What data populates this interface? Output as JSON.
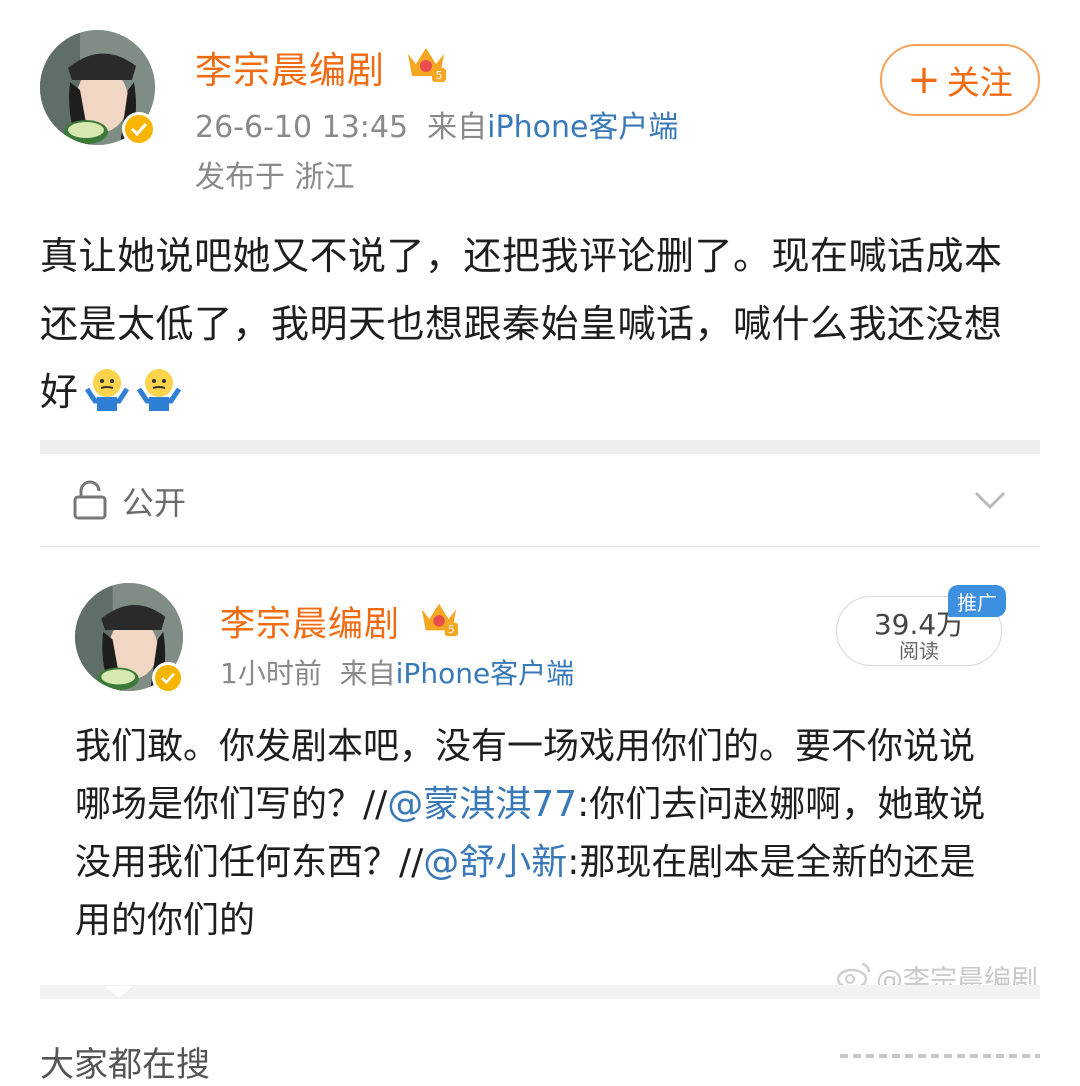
{
  "post": {
    "author": "李宗晨编剧",
    "timestamp": "26-6-10 13:45",
    "source_prefix": "来自",
    "source_name": "iPhone客户端",
    "location": "发布于 浙江",
    "follow_label": "关注",
    "text": "真让她说吧她又不说了，还把我评论删了。现在喊话成本还是太低了，我明天也想跟秦始皇喊话，喊什么我还没想好"
  },
  "visibility": {
    "label": "公开",
    "icon": "lock-icon"
  },
  "repost": {
    "author": "李宗晨编剧",
    "time": "1小时前",
    "source_prefix": "来自",
    "source_name": "iPhone客户端",
    "reads": "39.4万",
    "reads_label": "阅读",
    "promo": "推广",
    "text_part1": "我们敢。你发剧本吧，没有一场戏用你们的。要不你说说哪场是你们写的？//",
    "mention1": "@蒙淇淇77",
    "text_part2": ":你们去问赵娜啊，她敢说没用我们任何东西？//",
    "mention2": "@舒小新",
    "text_part3": ":那现在剧本是全新的还是用的你们的"
  },
  "watermark": "@李宗晨编剧",
  "trending": {
    "label": "大家都在搜"
  },
  "colors": {
    "name": "#f16b12",
    "link": "#3a79b8",
    "verified": "#f7b500",
    "promo": "#3d8fe0"
  }
}
